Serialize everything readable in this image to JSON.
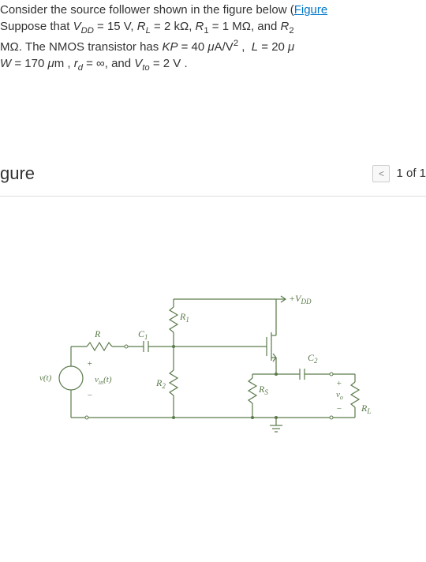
{
  "problem": {
    "line1_prefix": "Consider the source follower shown in the figure below (",
    "figure_link": "Figure",
    "line2": "Suppose that V_DD = 15 V, R_L = 2 kΩ, R_1 = 1 MΩ, and R_2",
    "line3": "MΩ. The NMOS transistor has KP = 40 μA/V², L = 20 μ",
    "line4": "W = 170 μm , r_d = ∞, and V_to = 2 V ."
  },
  "figure_section": {
    "title": "gure",
    "pager_text": "1 of 1"
  },
  "circuit": {
    "vdd_label": "+V_DD",
    "r1_label": "R₁",
    "r2_label": "R₂",
    "r_label": "R",
    "rs_label": "R_S",
    "rl_label": "R_L",
    "c1_label": "C₁",
    "c2_label": "C₂",
    "vin_src": "v(t)",
    "vin_label": "v_in(t)",
    "vo_label": "v_o",
    "plus": "+",
    "minus": "−"
  }
}
